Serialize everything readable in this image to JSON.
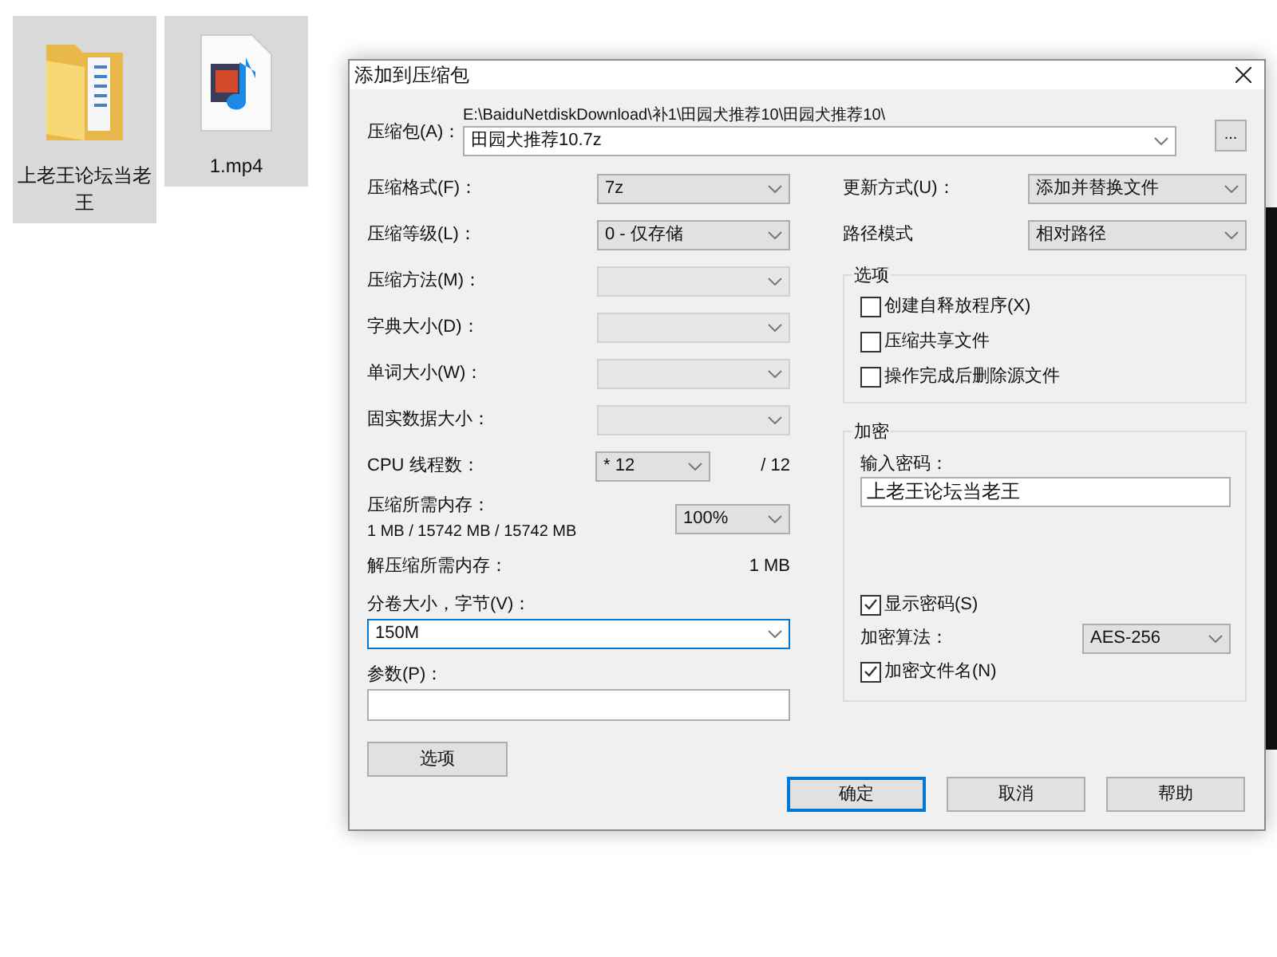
{
  "desktop_icons": [
    {
      "kind": "folder",
      "label": "上老王论坛当老王",
      "selected": true
    },
    {
      "kind": "video",
      "label": "1.mp4",
      "selected": true
    }
  ],
  "dialog": {
    "title": "添加到压缩包",
    "archive": {
      "label": "压缩包(A)：",
      "path": "E:\\BaiduNetdiskDownload\\补1\\田园犬推荐10\\田园犬推荐10\\",
      "filename": "田园犬推荐10.7z",
      "browse": "..."
    },
    "left_fields": [
      {
        "label": "压缩格式(F)：",
        "value": "7z",
        "disabled": false
      },
      {
        "label": "压缩等级(L)：",
        "value": "0 - 仅存储",
        "disabled": false
      },
      {
        "label": "压缩方法(M)：",
        "disabled": true
      },
      {
        "label": "字典大小(D)：",
        "disabled": true
      },
      {
        "label": "单词大小(W)：",
        "disabled": true
      },
      {
        "label": "固实数据大小：",
        "disabled": true
      }
    ],
    "cpu": {
      "label": "CPU 线程数：",
      "value": "* 12",
      "total": "/ 12"
    },
    "memory": {
      "label": "压缩所需内存：",
      "detail": "1 MB / 15742 MB / 15742 MB",
      "value": "100%"
    },
    "decompress_memory": {
      "label": "解压缩所需内存：",
      "value": "1 MB"
    },
    "volume": {
      "label": "分卷大小，字节(V)：",
      "value": "150M",
      "focused": true
    },
    "params": {
      "label": "参数(P)："
    },
    "options_button": "选项",
    "right_fields": [
      {
        "label": "更新方式(U)：",
        "value": "添加并替换文件"
      },
      {
        "label": "路径模式",
        "value": "相对路径"
      }
    ],
    "options_group": {
      "title": "选项",
      "checkboxes": [
        {
          "label": "创建自释放程序(X)",
          "checked": false
        },
        {
          "label": "压缩共享文件",
          "checked": false
        },
        {
          "label": "操作完成后删除源文件",
          "checked": false
        }
      ]
    },
    "encryption": {
      "title": "加密",
      "password_label": "输入密码：",
      "password": "上老王论坛当老王",
      "show_password": {
        "label": "显示密码(S)",
        "checked": true
      },
      "method_label": "加密算法：",
      "method": "AES-256",
      "encrypt_names": {
        "label": "加密文件名(N)",
        "checked": true
      }
    },
    "buttons": [
      {
        "label": "确定",
        "default": true
      },
      {
        "label": "取消",
        "default": false
      },
      {
        "label": "帮助",
        "default": false
      }
    ]
  }
}
